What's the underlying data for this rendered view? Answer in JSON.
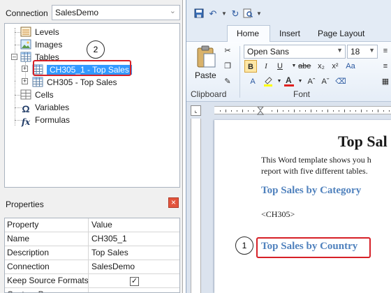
{
  "connection": {
    "label": "Connection",
    "value": "SalesDemo"
  },
  "tree": {
    "items": [
      {
        "label": "Levels",
        "icon": "levels-icon"
      },
      {
        "label": "Images",
        "icon": "images-icon"
      },
      {
        "label": "Tables",
        "icon": "table-icon"
      },
      {
        "label": "CH305_1 -  Top Sales",
        "icon": "table-icon",
        "selected": true
      },
      {
        "label": "CH305 -  Top Sales",
        "icon": "table-icon"
      },
      {
        "label": "Cells",
        "icon": "cells-icon"
      },
      {
        "label": "Variables",
        "icon": "omega-icon"
      },
      {
        "label": "Formulas",
        "icon": "fx-icon"
      }
    ]
  },
  "callouts": {
    "one": "1",
    "two": "2"
  },
  "properties": {
    "title": "Properties",
    "headers": [
      "Property",
      "Value"
    ],
    "rows": [
      {
        "key": "Name",
        "value": "CH305_1"
      },
      {
        "key": "Description",
        "value": " Top Sales"
      },
      {
        "key": "Connection",
        "value": "SalesDemo"
      },
      {
        "key": "Keep Source Formats",
        "value": "",
        "checked": true
      },
      {
        "key": "Custom P...",
        "value": ""
      }
    ]
  },
  "word": {
    "tabs": [
      "Home",
      "Insert",
      "Page Layout"
    ],
    "active_tab": "Home",
    "ribbon": {
      "paste_label": "Paste",
      "clipboard_label": "Clipboard",
      "font_label": "Font",
      "font_name": "Open Sans",
      "font_size": "18"
    },
    "document": {
      "title": "Top Sal",
      "para_line1": "This Word template shows you h",
      "para_line2": "report with five different tables.",
      "heading1": "Top Sales by Category",
      "tag": "<CH305>",
      "heading2": "Top Sales by Country"
    }
  },
  "colors": {
    "selection": "#3399ff",
    "callout_border": "#d62027",
    "heading": "#4f81bd"
  }
}
